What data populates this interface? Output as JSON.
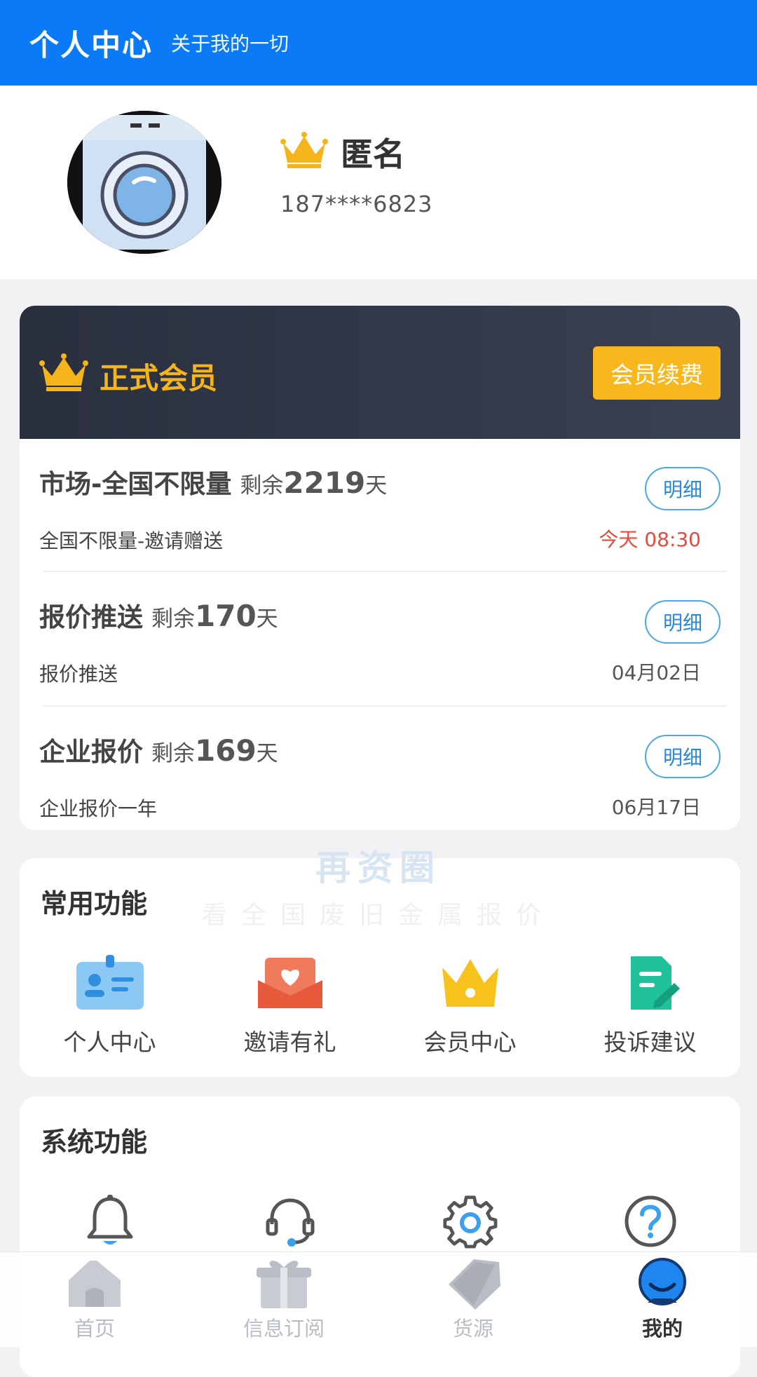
{
  "header": {
    "title": "个人中心",
    "subtitle": "关于我的一切"
  },
  "profile": {
    "username": "匿名",
    "phone": "187****6823"
  },
  "membership": {
    "title": "正式会员",
    "renew_label": "会员续费",
    "accent": "#f8b81d",
    "plans": [
      {
        "name": "市场-全国不限量",
        "remaining_label": "剩余",
        "remaining_days": "2219",
        "unit": "天",
        "desc": "全国不限量-邀请赠送",
        "date": "今天 08:30",
        "detail_label": "明细"
      },
      {
        "name": "报价推送",
        "remaining_label": "剩余",
        "remaining_days": "170",
        "unit": "天",
        "desc": "报价推送",
        "date": "04月02日",
        "detail_label": "明细"
      },
      {
        "name": "企业报价",
        "remaining_label": "剩余",
        "remaining_days": "169",
        "unit": "天",
        "desc": "企业报价一年",
        "date": "06月17日",
        "detail_label": "明细"
      }
    ]
  },
  "watermark": {
    "line1": "再资圈",
    "line2": "看全国废旧金属报价"
  },
  "common": {
    "title": "常用功能",
    "items": [
      {
        "label": "个人中心",
        "icon": "id-card-icon"
      },
      {
        "label": "邀请有礼",
        "icon": "gift-envelope-icon"
      },
      {
        "label": "会员中心",
        "icon": "crown-icon"
      },
      {
        "label": "投诉建议",
        "icon": "edit-document-icon"
      }
    ]
  },
  "system": {
    "title": "系统功能",
    "items": [
      {
        "icon": "bell-icon"
      },
      {
        "icon": "headset-icon"
      },
      {
        "icon": "gear-icon"
      },
      {
        "icon": "help-icon"
      }
    ]
  },
  "tabbar": {
    "items": [
      {
        "label": "首页",
        "icon": "home-icon"
      },
      {
        "label": "信息订阅",
        "icon": "gift-box-icon"
      },
      {
        "label": "货源",
        "icon": "tag-icon"
      },
      {
        "label": "我的",
        "icon": "user-mascot-icon",
        "active": true
      }
    ]
  }
}
